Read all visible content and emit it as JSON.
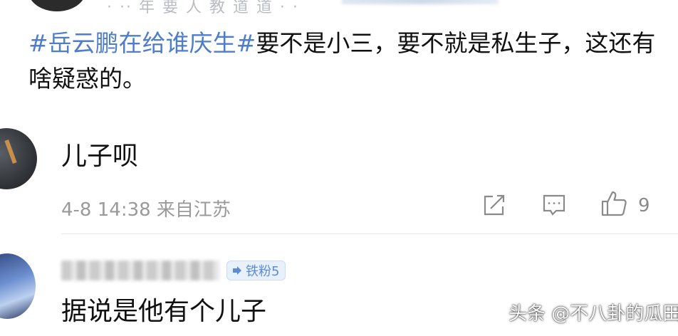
{
  "top_cut": {
    "text": "· ·· 年 要 人 教 道 道 · ·"
  },
  "post": {
    "hashtag": "#岳云鹏在给谁庆生#",
    "text": "要不是小三，要不就是私生子，这还有啥疑惑的。"
  },
  "comments": [
    {
      "text": "儿子呗",
      "meta": "4-8 14:38 来自江苏",
      "likes": "9"
    },
    {
      "badge": "铁粉5",
      "text": "据说是他有个儿子"
    }
  ],
  "icons": {
    "share": "share-icon",
    "comment": "comment-icon",
    "like": "thumbs-up-icon",
    "badge": "arrow-badge-icon"
  },
  "colors": {
    "hashtag": "#4d7dcb",
    "meta": "#9a9a9a",
    "badge_text": "#5b8cd6",
    "badge_bg": "#e8f0fb"
  },
  "watermark": "头条 @不八卦的瓜田"
}
